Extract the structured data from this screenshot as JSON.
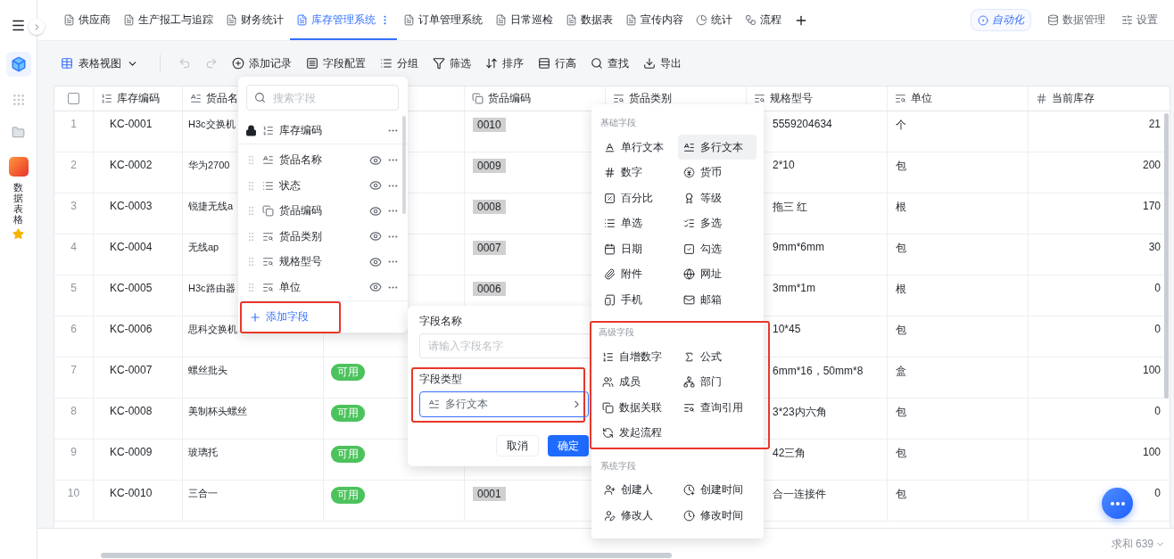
{
  "sidebar": {
    "app_label": "数据表格",
    "favorite": true
  },
  "tabs": [
    {
      "label": "供应商",
      "kind": "sheet",
      "selected": false
    },
    {
      "label": "生产报工与追踪",
      "kind": "sheet",
      "selected": false
    },
    {
      "label": "财务统计",
      "kind": "sheet",
      "selected": false
    },
    {
      "label": "库存管理系统",
      "kind": "sheet",
      "selected": true
    },
    {
      "label": "订单管理系统",
      "kind": "sheet",
      "selected": false
    },
    {
      "label": "日常巡检",
      "kind": "sheet",
      "selected": false
    },
    {
      "label": "数据表",
      "kind": "sheet",
      "selected": false
    },
    {
      "label": "宣传内容",
      "kind": "sheet",
      "selected": false
    },
    {
      "label": "统计",
      "kind": "chart",
      "selected": false
    },
    {
      "label": "流程",
      "kind": "flow",
      "selected": false
    }
  ],
  "header_actions": [
    {
      "label": "自动化",
      "kind": "automation"
    },
    {
      "label": "数据管理",
      "kind": "database"
    },
    {
      "label": "设置",
      "kind": "settings"
    }
  ],
  "toolbar": {
    "view": "表格视图",
    "actions": [
      {
        "label": "添加记录",
        "kind": "add"
      },
      {
        "label": "字段配置",
        "kind": "fields"
      },
      {
        "label": "分组",
        "kind": "group"
      },
      {
        "label": "筛选",
        "kind": "filter"
      },
      {
        "label": "排序",
        "kind": "sort"
      },
      {
        "label": "行高",
        "kind": "height"
      },
      {
        "label": "查找",
        "kind": "search"
      },
      {
        "label": "导出",
        "kind": "export"
      }
    ]
  },
  "table": {
    "select_all": {
      "checked": false
    },
    "columns": [
      {
        "label": "库存编码",
        "kind": "autonumber"
      },
      {
        "label": "货品名",
        "kind": "multiline"
      },
      null,
      {
        "label": "货品编码",
        "kind": "link"
      },
      {
        "label": "货品类别",
        "kind": "lookup"
      },
      {
        "label": "规格型号",
        "kind": "lookup"
      },
      {
        "label": "单位",
        "kind": "lookup"
      },
      {
        "label": "当前库存",
        "kind": "number"
      }
    ],
    "rows": [
      {
        "number": "1",
        "code": "KC-0001",
        "name": "H3c交换机",
        "item_code": "0010",
        "spec": "5559204634",
        "unit": "个",
        "stock": "21"
      },
      {
        "number": "2",
        "code": "KC-0002",
        "name": "华为2700",
        "item_code": "0009",
        "spec": "2*10",
        "unit": "包",
        "stock": "200"
      },
      {
        "number": "3",
        "code": "KC-0003",
        "name": "锐捷无线a",
        "item_code": "0008",
        "spec": "拖三 红",
        "unit": "根",
        "stock": "170"
      },
      {
        "number": "4",
        "code": "KC-0004",
        "name": "无线ap",
        "item_code": "0007",
        "spec": "9mm*6mm",
        "unit": "包",
        "stock": "30"
      },
      {
        "number": "5",
        "code": "KC-0005",
        "name": "H3c路由器",
        "item_code": "0006",
        "spec": "3mm*1m",
        "unit": "根",
        "stock": "0"
      },
      {
        "number": "6",
        "code": "KC-0006",
        "name": "思科交换机",
        "spec": "10*45",
        "unit": "包",
        "stock": "0"
      },
      {
        "number": "7",
        "code": "KC-0007",
        "name": "螺丝批头",
        "status": "可用",
        "spec": "6mm*16，50mm*8",
        "unit": "盒",
        "stock": "100"
      },
      {
        "number": "8",
        "code": "KC-0008",
        "name": "美制杯头螺丝",
        "status": "可用",
        "spec": "3*23内六角",
        "unit": "包",
        "stock": "0"
      },
      {
        "number": "9",
        "code": "KC-0009",
        "name": "玻璃托",
        "status": "可用",
        "spec": "42三角",
        "unit": "包",
        "stock": "100"
      },
      {
        "number": "10",
        "code": "KC-0010",
        "name": "三合一",
        "status": "可用",
        "item_code": "0001",
        "spec": "合一连接件",
        "unit": "包",
        "stock": "0"
      }
    ]
  },
  "footer": {
    "summary": "求和 639"
  },
  "field_config": {
    "search": {
      "placeholder": "搜索字段"
    },
    "fields": [
      {
        "label": "库存编码",
        "kind": "autonumber",
        "locked": true
      },
      {
        "label": "货品名称",
        "kind": "multiline",
        "locked": false
      },
      {
        "label": "状态",
        "kind": "select",
        "locked": false
      },
      {
        "label": "货品编码",
        "kind": "link",
        "locked": false
      },
      {
        "label": "货品类别",
        "kind": "lookup",
        "locked": false
      },
      {
        "label": "规格型号",
        "kind": "lookup",
        "locked": false
      },
      {
        "label": "单位",
        "kind": "lookup",
        "locked": false
      }
    ],
    "add_button": {
      "label": "添加字段",
      "highlighted": true
    }
  },
  "add_field": {
    "name_label": "字段名称",
    "name_placeholder": "请输入字段名字",
    "type_label": "字段类型",
    "type_field": {
      "value": "多行文本",
      "kind": "multiline",
      "highlighted": true
    },
    "cancel": "取消",
    "confirm": "确定"
  },
  "type_menu": [
    {
      "title": "基础字段",
      "highlighted": false,
      "items": [
        {
          "label": "单行文本",
          "kind": "text",
          "selected": false
        },
        {
          "label": "多行文本",
          "kind": "multiline",
          "selected": true
        },
        {
          "label": "数字",
          "kind": "number",
          "selected": false
        },
        {
          "label": "货币",
          "kind": "currency",
          "selected": false
        },
        {
          "label": "百分比",
          "kind": "percent",
          "selected": false
        },
        {
          "label": "等级",
          "kind": "rating",
          "selected": false
        },
        {
          "label": "单选",
          "kind": "select",
          "selected": false
        },
        {
          "label": "多选",
          "kind": "multiselect",
          "selected": false
        },
        {
          "label": "日期",
          "kind": "date",
          "selected": false
        },
        {
          "label": "勾选",
          "kind": "checkbox",
          "selected": false
        },
        {
          "label": "附件",
          "kind": "attachment",
          "selected": false
        },
        {
          "label": "网址",
          "kind": "url",
          "selected": false
        },
        {
          "label": "手机",
          "kind": "phone",
          "selected": false
        },
        {
          "label": "邮箱",
          "kind": "email",
          "selected": false
        }
      ]
    },
    {
      "title": "高级字段",
      "highlighted": true,
      "items": [
        {
          "label": "自增数字",
          "kind": "autonumber",
          "selected": false
        },
        {
          "label": "公式",
          "kind": "formula",
          "selected": false
        },
        {
          "label": "成员",
          "kind": "member",
          "selected": false
        },
        {
          "label": "部门",
          "kind": "department",
          "selected": false
        },
        {
          "label": "数据关联",
          "kind": "link",
          "selected": false
        },
        {
          "label": "查询引用",
          "kind": "lookup",
          "selected": false
        },
        {
          "label": "发起流程",
          "kind": "flow",
          "selected": false
        }
      ]
    },
    {
      "title": "系统字段",
      "highlighted": false,
      "items": [
        {
          "label": "创建人",
          "kind": "creator",
          "selected": false
        },
        {
          "label": "创建时间",
          "kind": "created_time",
          "selected": false
        },
        {
          "label": "修改人",
          "kind": "modifier",
          "selected": false
        },
        {
          "label": "修改时间",
          "kind": "modified_time",
          "selected": false
        }
      ]
    }
  ]
}
